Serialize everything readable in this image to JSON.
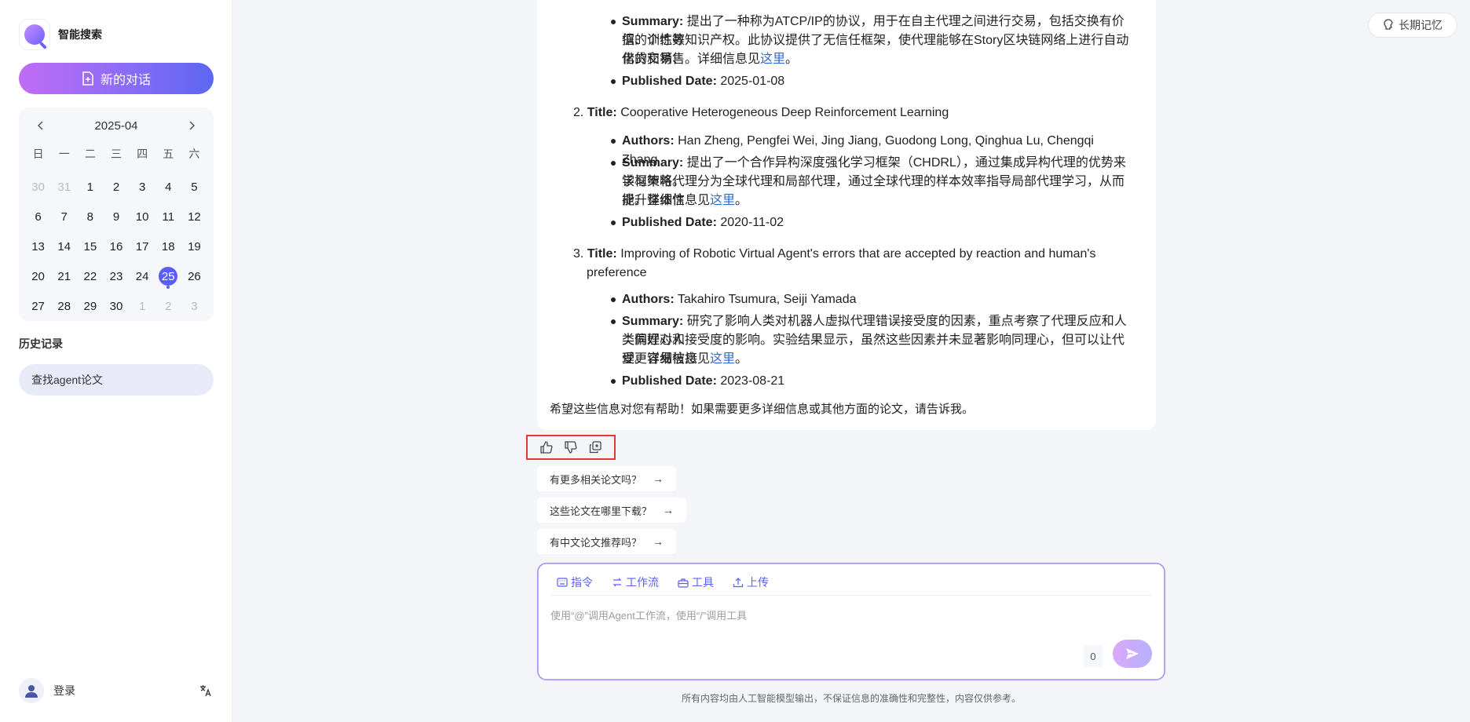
{
  "sidebar": {
    "brand_name": "智能搜索",
    "new_chat_label": "新的对话",
    "calendar": {
      "title": "2025-04",
      "weekdays": [
        "日",
        "一",
        "二",
        "三",
        "四",
        "五",
        "六"
      ],
      "days": [
        {
          "label": "30",
          "muted": true
        },
        {
          "label": "31",
          "muted": true
        },
        {
          "label": "1"
        },
        {
          "label": "2"
        },
        {
          "label": "3"
        },
        {
          "label": "4"
        },
        {
          "label": "5"
        },
        {
          "label": "6"
        },
        {
          "label": "7"
        },
        {
          "label": "8"
        },
        {
          "label": "9"
        },
        {
          "label": "10"
        },
        {
          "label": "11"
        },
        {
          "label": "12"
        },
        {
          "label": "13"
        },
        {
          "label": "14"
        },
        {
          "label": "15"
        },
        {
          "label": "16"
        },
        {
          "label": "17"
        },
        {
          "label": "18"
        },
        {
          "label": "19"
        },
        {
          "label": "20"
        },
        {
          "label": "21"
        },
        {
          "label": "22"
        },
        {
          "label": "23"
        },
        {
          "label": "24"
        },
        {
          "label": "25",
          "selected": true
        },
        {
          "label": "26"
        },
        {
          "label": "27"
        },
        {
          "label": "28"
        },
        {
          "label": "29"
        },
        {
          "label": "30"
        },
        {
          "label": "1",
          "muted": true
        },
        {
          "label": "2",
          "muted": true
        },
        {
          "label": "3",
          "muted": true
        }
      ]
    },
    "history_title": "历史记录",
    "history_items": [
      "查找agent论文"
    ],
    "login_label": "登录"
  },
  "header": {
    "memory_label": "长期记忆"
  },
  "message": {
    "papers": [
      {
        "number": "",
        "summary_label": "Summary:",
        "summary_lines": [
          "提出了一种称为ATCP/IP的协议，用于在自主代理之间进行交易，包括交换有价值的训练数",
          "据、个性等知识产权。此协议提供了无信任框架，使代理能够在Story区块链网络上进行自动化的交易、"
        ],
        "summary_tail": "借贷和销售。详细信息见",
        "link_text": "这里",
        "date_label": "Published Date:",
        "date": "2025-01-08"
      },
      {
        "number": "2.",
        "title_label": "Title:",
        "title_lines": [
          "Cooperative Heterogeneous Deep Reinforcement Learning"
        ],
        "authors_label": "Authors:",
        "authors": "Han Zheng, Pengfei Wei, Jing Jiang, Guodong Long, Qinghua Lu, Chengqi Zhang",
        "summary_label": "Summary:",
        "summary_lines": [
          "提出了一个合作异构深度强化学习框架（CHDRL），通过集成异构代理的优势来学习策略。",
          "该框架将代理分为全球代理和局部代理，通过全球代理的样本效率指导局部代理学习，从而提升整体性"
        ],
        "summary_tail": "能。详细信息见",
        "link_text": "这里",
        "date_label": "Published Date:",
        "date": "2020-11-02"
      },
      {
        "number": "3.",
        "title_label": "Title:",
        "title_lines": [
          "Improving of Robotic Virtual Agent's errors that are accepted by reaction and human's",
          "preference"
        ],
        "authors_label": "Authors:",
        "authors": "Takahiro Tsumura, Seiji Yamada",
        "summary_label": "Summary:",
        "summary_lines": [
          "研究了影响人类对机器人虚拟代理错误接受度的因素，重点考察了代理反应和人类偏好对人",
          "类同理心和接受度的影响。实验结果显示，虽然这些因素并未显著影响同理心，但可以让代理更容易被接"
        ],
        "summary_tail": "受。详细信息见",
        "link_text": "这里",
        "date_label": "Published Date:",
        "date": "2023-08-21"
      }
    ],
    "closing": "希望这些信息对您有帮助！如果需要更多详细信息或其他方面的论文，请告诉我。"
  },
  "suggestions": [
    "有更多相关论文吗？",
    "这些论文在哪里下载？",
    "有中文论文推荐吗？"
  ],
  "composer": {
    "tools": [
      "指令",
      "工作流",
      "工具",
      "上传"
    ],
    "placeholder": "使用“@”调用Agent工作流，使用“/”调用工具",
    "char_count": "0"
  },
  "disclaimer": "所有内容均由人工智能模型输出，不保证信息的准确性和完整性，内容仅供参考。"
}
